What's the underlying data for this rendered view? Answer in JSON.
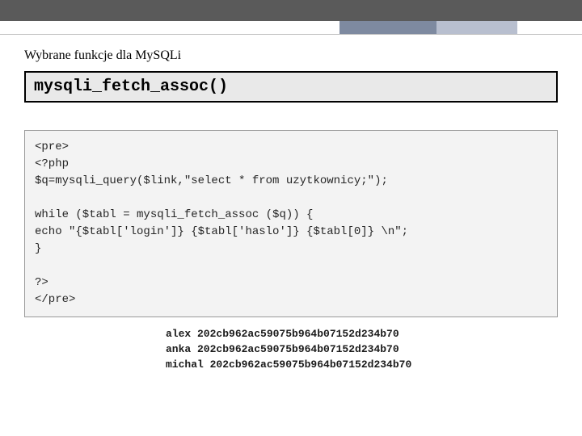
{
  "heading": "Wybrane funkcje dla MySQLi",
  "title": "mysqli_fetch_assoc()",
  "code": "<pre>\n<?php\n$q=mysqli_query($link,\"select * from uzytkownicy;\");\n\nwhile ($tabl = mysqli_fetch_assoc ($q)) {\necho \"{$tabl['login']} {$tabl['haslo']} {$tabl[0]} \\n\";\n}\n\n?>\n</pre>",
  "output_rows": [
    {
      "login": "alex",
      "hash": "202cb962ac59075b964b07152d234b70"
    },
    {
      "login": "anka",
      "hash": "202cb962ac59075b964b07152d234b70"
    },
    {
      "login": "michal",
      "hash": "202cb962ac59075b964b07152d234b70"
    }
  ]
}
